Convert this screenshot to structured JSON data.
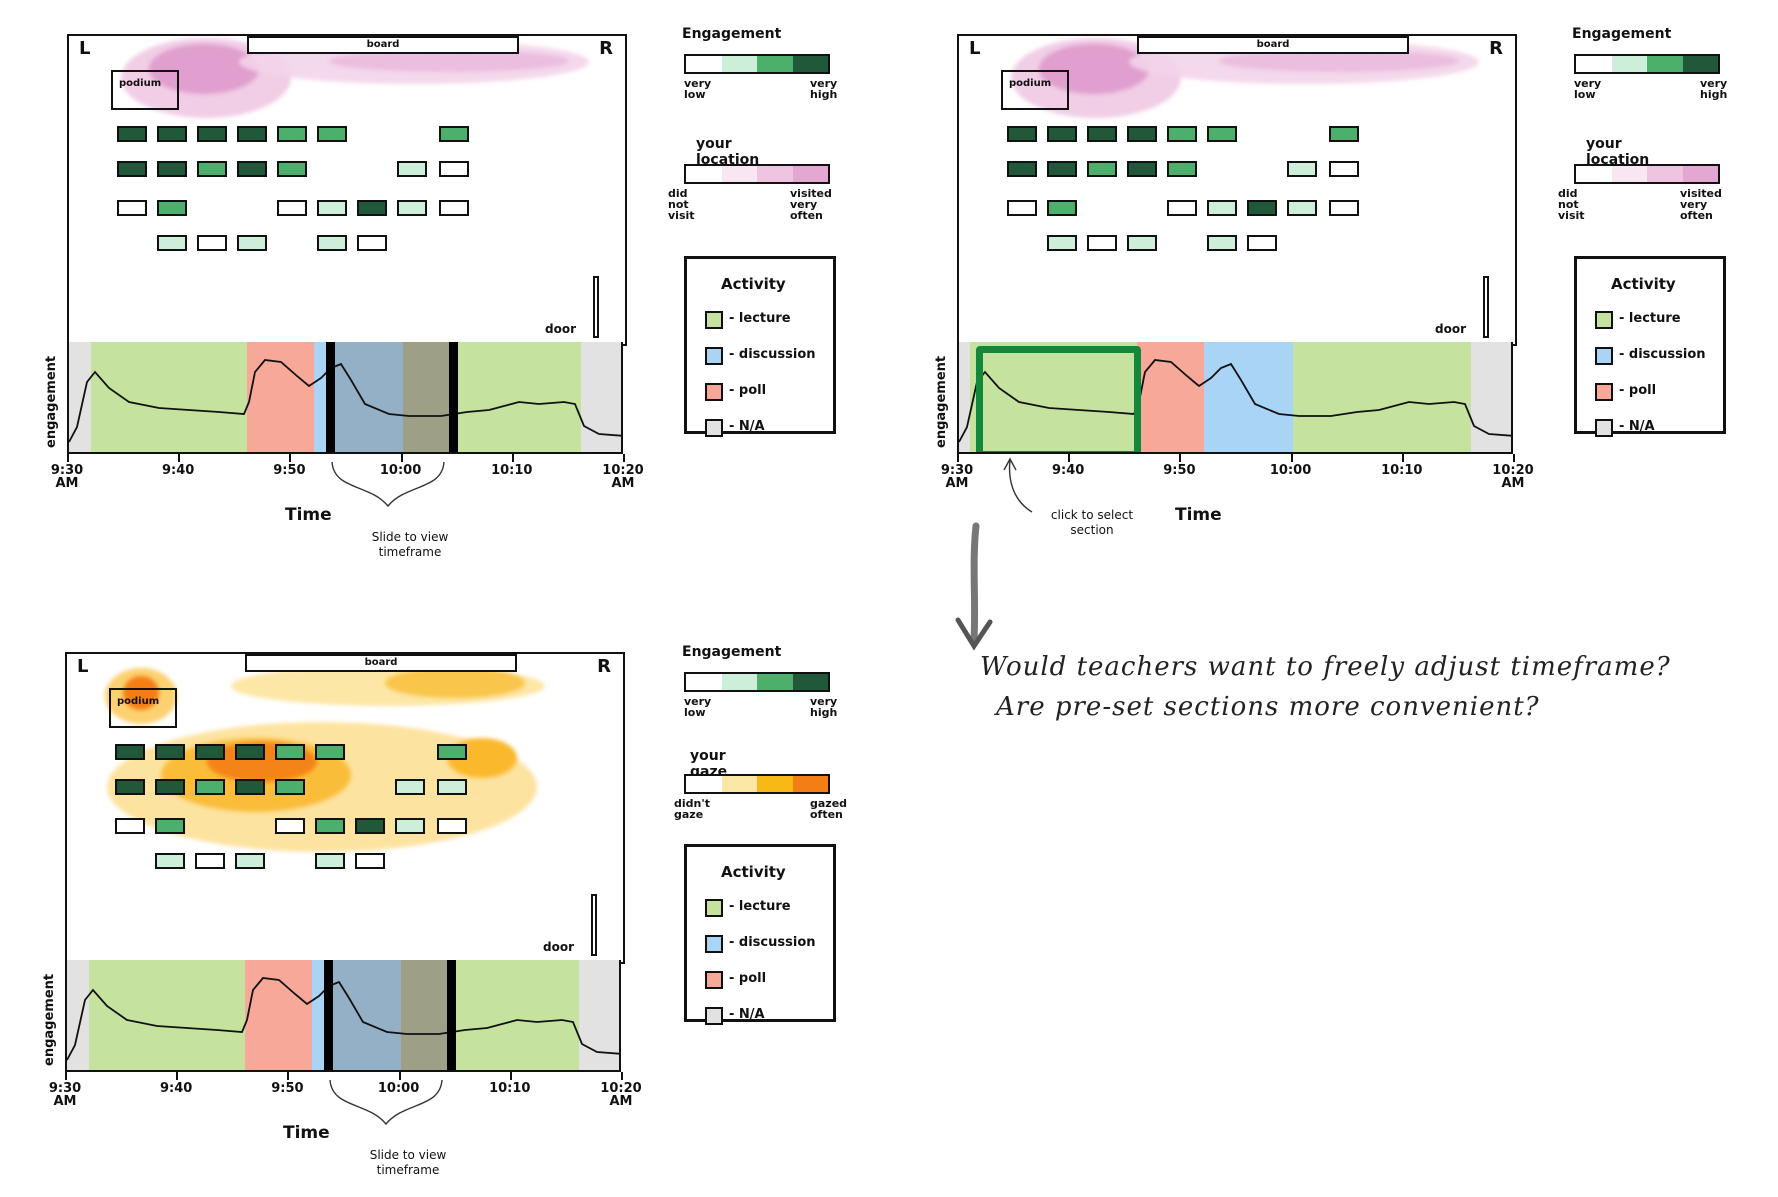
{
  "colors": {
    "lecture": "#c5e39f",
    "discussion": "#aad4f6",
    "poll": "#f7a899",
    "na": "#e2e2e2",
    "eng1": "#ffffff",
    "eng2": "#cdeed9",
    "eng3": "#4cb06c",
    "eng4": "#22583a",
    "loc": "#e4a7d2",
    "gaze_light": "#fde7a6",
    "gaze_mid": "#f7b916",
    "gaze_dark": "#f47e15",
    "highlight": "#14883a"
  },
  "room": {
    "left": "L",
    "right": "R",
    "board": "board",
    "podium": "podium",
    "door": "door"
  },
  "timeline": {
    "y_label": "engagement",
    "x_title": "Time",
    "ticks": [
      "9:30\nAM",
      "9:40",
      "9:50",
      "10:00",
      "10:10",
      "10:20\nAM"
    ],
    "slide_note": "Slide to view\ntimeframe",
    "click_note": "click to select\nsection"
  },
  "legend": {
    "engagement_title": "Engagement",
    "engagement_low": "very\nlow",
    "engagement_high": "very\nhigh",
    "location_title": "your location",
    "location_low": "did not\nvisit",
    "location_high": "visited\nvery often",
    "gaze_title": "your gaze",
    "gaze_low": "didn't\ngaze",
    "gaze_high": "gazed\noften",
    "activity_title": "Activity",
    "activity_items": [
      "- lecture",
      "- discussion",
      "- poll",
      "- N/A"
    ]
  },
  "question": {
    "line1": "Would teachers want to freely adjust timeframe?",
    "line2": "Are pre-set sections more convenient?"
  }
}
